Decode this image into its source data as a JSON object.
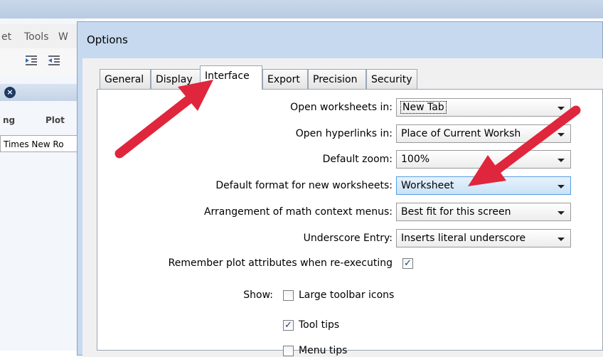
{
  "background_app": {
    "menu": [
      "et",
      "Tools",
      "W"
    ],
    "column_headers": [
      "ng",
      "Plot"
    ],
    "font_box": "Times New Ro"
  },
  "dialog": {
    "title": "Options",
    "tabs": [
      "General",
      "Display",
      "Interface",
      "Export",
      "Precision",
      "Security"
    ],
    "active_tab": "Interface"
  },
  "fields": {
    "open_worksheets": {
      "label": "Open worksheets in:",
      "value": "New Tab"
    },
    "open_hyperlinks": {
      "label": "Open hyperlinks in:",
      "value": "Place of Current Worksh"
    },
    "default_zoom": {
      "label": "Default zoom:",
      "value": "100%"
    },
    "default_format": {
      "label": "Default format for new worksheets:",
      "value": "Worksheet"
    },
    "arrangement": {
      "label": "Arrangement of math context menus:",
      "value": "Best fit for this screen"
    },
    "underscore": {
      "label": "Underscore Entry:",
      "value": "Inserts literal underscore"
    }
  },
  "remember_plot": {
    "label": "Remember plot attributes when re-executing",
    "checked": true
  },
  "show": {
    "label": "Show:",
    "large_toolbar_icons": {
      "label": "Large toolbar icons",
      "checked": false
    },
    "tool_tips": {
      "label": "Tool tips",
      "checked": true
    },
    "partial_item": {
      "label": "Menu tips",
      "checked": false
    }
  },
  "colors": {
    "arrow": "#e0263c",
    "dialog_frame": "#c6d9ef",
    "focus_combo": "#c9e2f7"
  }
}
